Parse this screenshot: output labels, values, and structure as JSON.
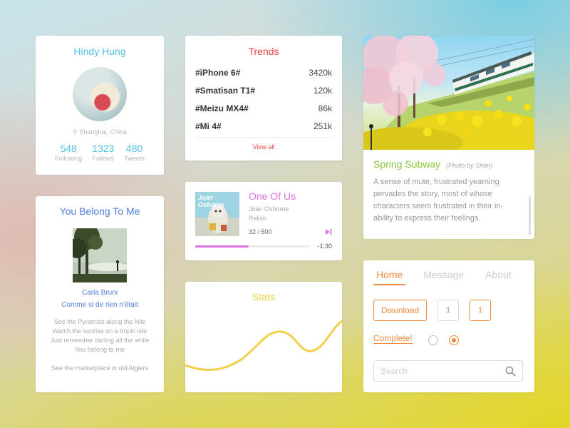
{
  "profile": {
    "name": "Hindy Hung",
    "location": "Shanghai, China",
    "stats": [
      {
        "value": "548",
        "label": "Following"
      },
      {
        "value": "1323",
        "label": "Follows"
      },
      {
        "value": "480",
        "label": "Tweets"
      }
    ]
  },
  "trends": {
    "title": "Trends",
    "items": [
      {
        "tag": "#iPhone 6#",
        "count": "3420k"
      },
      {
        "tag": "#Smatisan T1#",
        "count": "120k"
      },
      {
        "tag": "#Meizu MX4#",
        "count": "86k"
      },
      {
        "tag": "#Mi 4#",
        "count": "251k"
      }
    ],
    "view_all": "View all"
  },
  "photo": {
    "title": "Spring Subway",
    "credit": "(Photo by Shen)",
    "description": "A sense of mute, frustrated yearning pervades the story, most of whose characters seem frustrated in their in-ability to express their feelings."
  },
  "song": {
    "title": "You Belong To Me",
    "artist": "Carla Bruni",
    "album": "Comme si de rien n'était",
    "lyrics": [
      "See the Pyramids along the Nile",
      "Watch the sunrise on a tropic isle",
      "Just remember darling all the while",
      "You belong to me",
      "",
      "See the marketplace in old Algiers"
    ]
  },
  "player": {
    "art_text": "Joan Osborne",
    "title": "One Of Us",
    "artist": "Joan Osborne",
    "album": "Relish",
    "position": "32 / 500",
    "remaining": "-1:30",
    "progress": 0.47,
    "accent": "#e070e0"
  },
  "stats": {
    "title": "Stats",
    "color": "#f2d04a"
  },
  "controls": {
    "tabs": [
      "Home",
      "Message",
      "About"
    ],
    "active_tab": "Home",
    "download_label": "Download",
    "num_boxes": [
      "1",
      "1"
    ],
    "complete_label": "Complete!",
    "search_placeholder": "Search",
    "accent": "#f08a3c"
  }
}
